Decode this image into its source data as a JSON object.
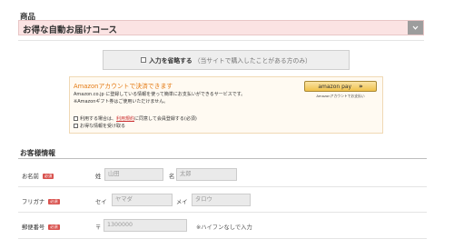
{
  "product": {
    "label": "商品",
    "selected_course": "お得な自動お届けコース"
  },
  "skip_input": {
    "label": "入力を省略する",
    "note": "（当サイトで購入したことがある方のみ）"
  },
  "amazon": {
    "title": "Amazonアカウントで決済できます",
    "description": "Amazon.co.jp に登録している情報を使って簡単にお支払いができるサービスです。",
    "note": "※Amazonギフト券はご使用いただけません。",
    "terms_prefix": "利用する場合は、",
    "terms_link": "利用規約",
    "terms_suffix": "に同意して会員登録する(必須)",
    "newsletter": "お得な情報を受け取る",
    "button_label": "amazon pay",
    "button_arrow": "»",
    "button_caption": "Amazonアカウントでお支払い"
  },
  "customer": {
    "section_title": "お客様情報",
    "required_badge": "必須",
    "name": {
      "label": "お名前",
      "last_prefix": "姓",
      "last_placeholder": "山田",
      "first_prefix": "名",
      "first_placeholder": "太郎"
    },
    "furigana": {
      "label": "フリガナ",
      "last_prefix": "セイ",
      "last_placeholder": "ヤマダ",
      "first_prefix": "メイ",
      "first_placeholder": "タロウ"
    },
    "postal": {
      "label": "郵便番号",
      "prefix": "〒",
      "placeholder": "1300000",
      "hint": "※ハイフンなしで入力"
    }
  }
}
